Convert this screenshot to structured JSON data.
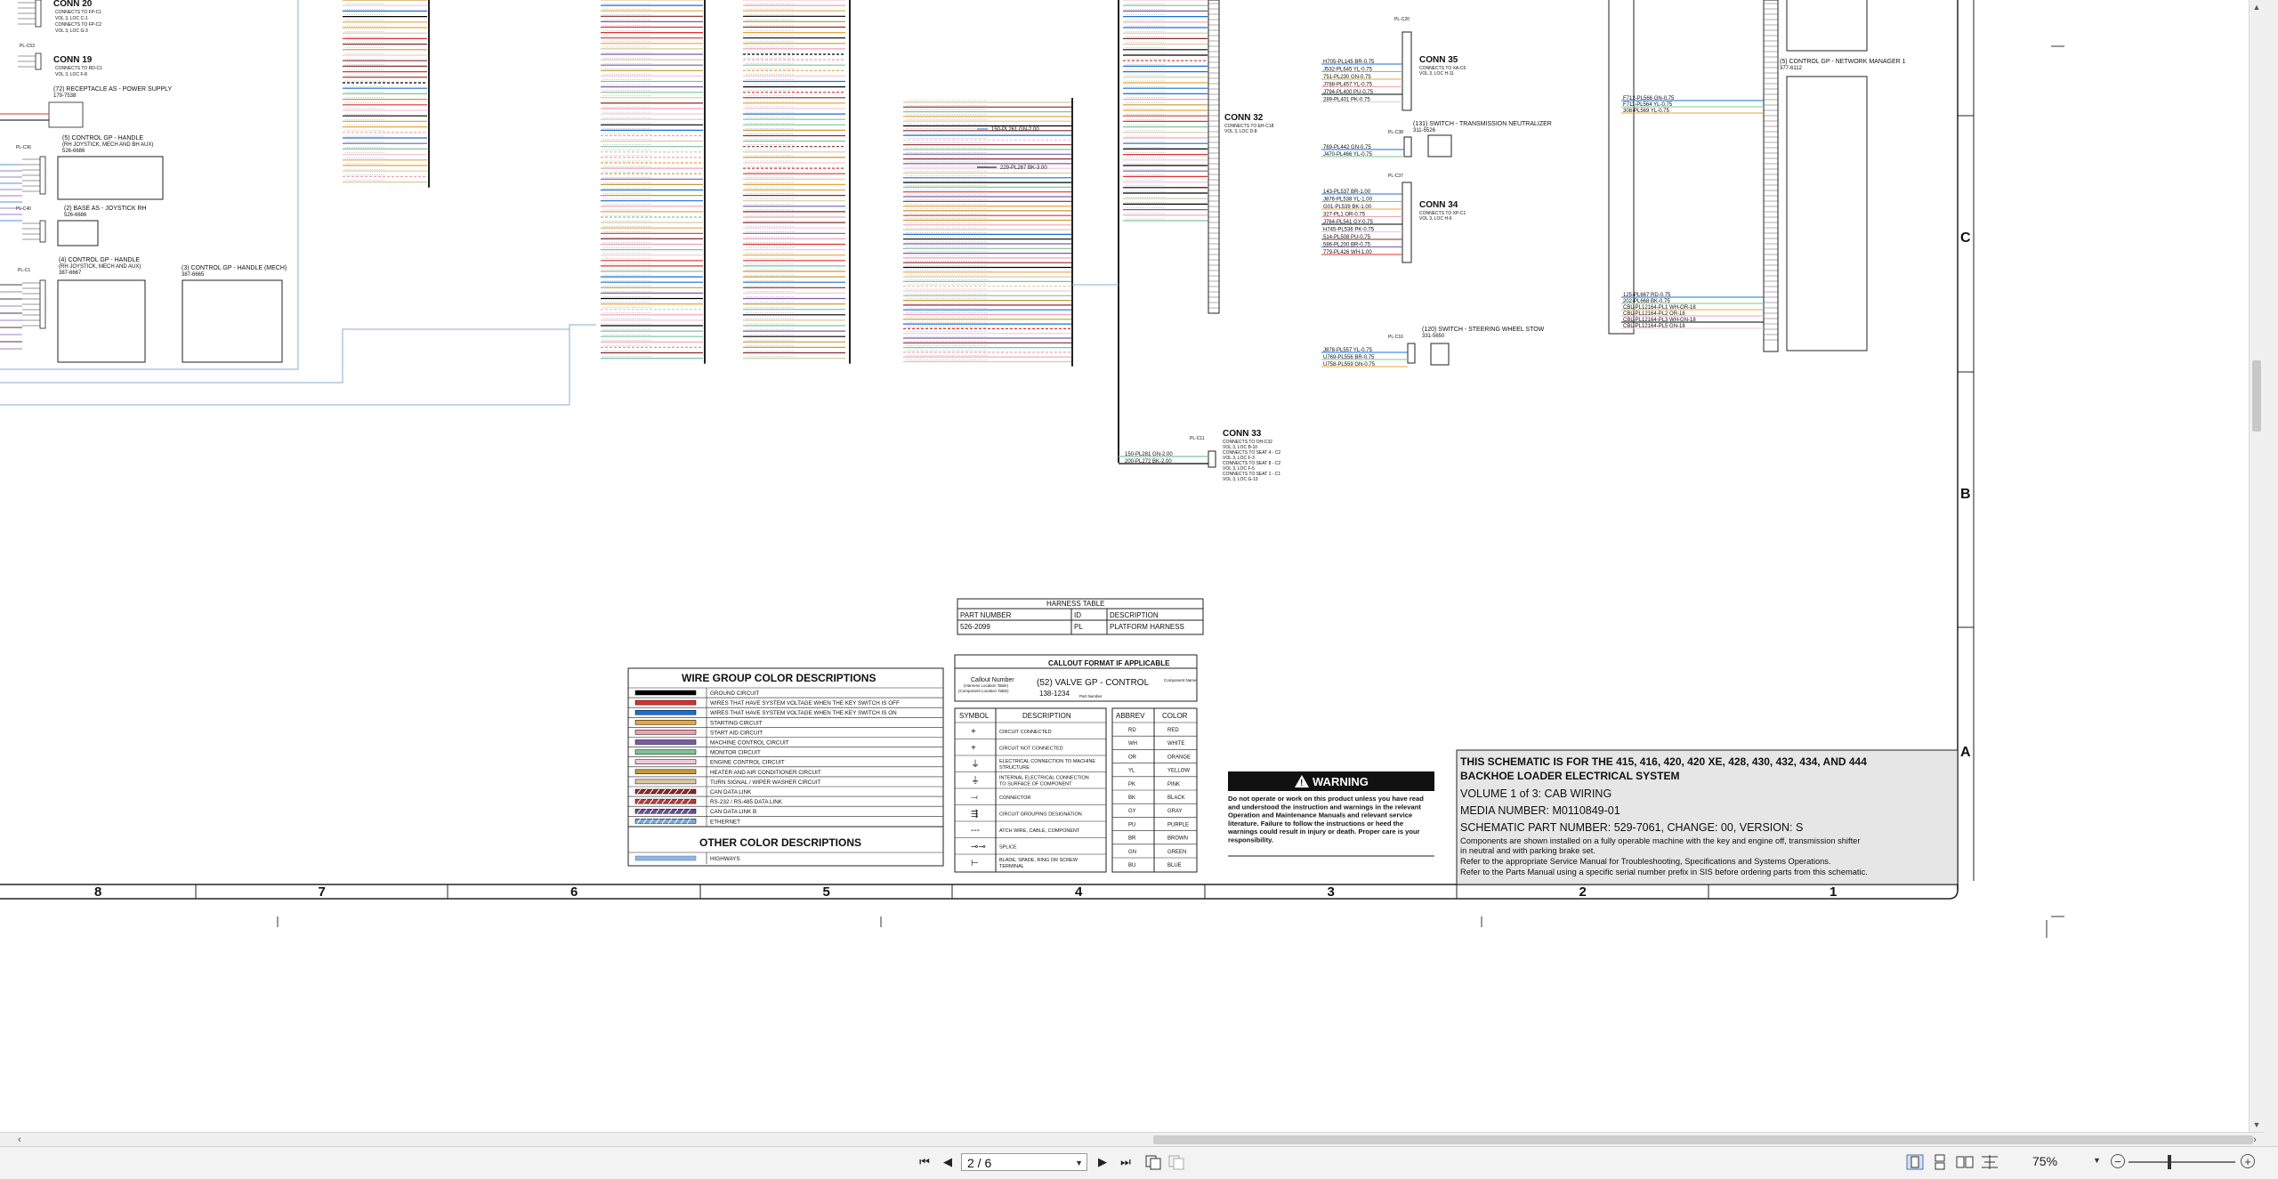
{
  "viewer": {
    "page_field": "2 / 6",
    "zoom": "75%",
    "nav": {
      "first": "⏮",
      "prev": "◀",
      "next": "▶",
      "last": "⏭"
    }
  },
  "schematic": {
    "zone_columns": [
      "8",
      "7",
      "6",
      "5",
      "4",
      "3",
      "2",
      "1"
    ],
    "zone_rows": [
      "C",
      "B",
      "A"
    ],
    "connectors_left": {
      "conn20": {
        "name": "CONN 20",
        "desc": [
          "CONNECTS TO FP-C1",
          "VOL 3, LOC C-1",
          "CONNECTS TO FP-C2",
          "VOL 3, LOC G-3"
        ]
      },
      "conn19": {
        "name": "CONN 19",
        "desc": [
          "CONNECTS TO RD-C1",
          "VOL 3, LOC F-8"
        ]
      },
      "plc53": "PL-C53",
      "receptacle": {
        "title": "(72) RECEPTACLE AS - POWER SUPPLY",
        "part": "179-7538"
      },
      "plc36": "PL-C36",
      "control5": {
        "title": "(5) CONTROL GP - HANDLE",
        "sub": "(RH JOYSTICK, MECH AND BH AUX)",
        "part": "526-6686"
      },
      "plc40": "PL-C40",
      "base": {
        "title": "(2) BASE AS - JOYSTICK RH",
        "part": "526-6686"
      },
      "plc1": "PL-C1",
      "control4": {
        "title": "(4) CONTROL GP - HANDLE",
        "sub": "(RH JOYSTICK, MECH AND AUX)",
        "part": "387-6667"
      },
      "control3": {
        "title": "(3) CONTROL GP - HANDLE (MECH)",
        "part": "387-6665"
      }
    },
    "conns_mid": {
      "conn32": {
        "name": "CONN 32",
        "desc": [
          "CONNECTS TO EH-C18",
          "VOL 3, LOC D-8"
        ]
      },
      "conn33": {
        "name": "CONN 33",
        "desc": [
          "CONNECTS TO OH-C32",
          "VOL 3, LOC B-10",
          "CONNECTS TO SEAT 4 - C2",
          "VOL 3, LOC F-3",
          "CONNECTS TO SEAT 8 - C2",
          "VOL 3, LOC F-5",
          "CONNECTS TO SEAT 1 - C1",
          "VOL 3, LOC G-13"
        ]
      },
      "plc11": "PL-C11"
    },
    "conns_right": {
      "conn35": {
        "name": "CONN 35",
        "desc": [
          "CONNECTS TO XA-C6",
          "VOL 3, LOC H-11"
        ]
      },
      "conn34": {
        "name": "CONN 34",
        "desc": [
          "CONNECTS TO XP-C1",
          "VOL 3, LOC H-6"
        ]
      },
      "switch131": {
        "title": "(131) SWITCH - TRANSMISSION NEUTRALIZER",
        "part": "311-5526"
      },
      "switch120": {
        "title": "(120) SWITCH - STEERING WHEEL STOW",
        "part": "331-5650"
      },
      "network": {
        "title": "(5) CONTROL GP - NETWORK MANAGER 1",
        "part": "377-6112"
      },
      "plc20": "PL-C20",
      "plc38": "PL-C38",
      "plc37": "PL-C37",
      "plc16": "PL-C16"
    },
    "wire_labels": {
      "mid_inline": [
        "150-PL261 GN-2.00",
        "229-PL267 BK-3.00"
      ],
      "right_top": [
        "F712-PL566 GN-0.75",
        "F711-PL564 YL-0.75",
        "308-PL569 YL-0.75"
      ],
      "right_bottom": [
        "125-PL667 RD-0.75",
        "202-PL668 BK-0.75",
        "CBL-PL12164-PL1 WH-OR-18",
        "CBL-PL12164-PL2 OR-18",
        "CBL-PL12164-PL3 WH-GN-18",
        "CBL-PL12164-PL5 GN-18"
      ],
      "conn35_wires": [
        "H705-PL145 BR-0.75",
        "J532-PL645 YL-0.75",
        "751-PL230 GN-0.75",
        "J788-PL457 YL-0.75",
        "J794-PL400 PU-0.75",
        "289-PL401 PK-0.75"
      ],
      "switch131_wires": [
        "769-PL442 GN-0.75",
        "J470-PL466 YL-0.75"
      ],
      "conn34_wires": [
        "143-PL537 BR-1.00",
        "J876-PL538 YL-1.00",
        "G01-PL539 BK-1.00",
        "327-PL1 OR-0.75",
        "J764-PL541 GY-0.75",
        "H745-PL536 PK-0.75",
        "514-PL508 PU-0.75",
        "586-PL200 BR-0.75",
        "779-PL426 WH-1.00"
      ],
      "switch120_wires": [
        "J878-PL557 YL-0.75",
        "U769-PL556 BR-0.75",
        "U758-PL559 GN-0.75"
      ],
      "conn33_wires": [
        "150-PL281 GN-2.00",
        "200-PL272 BK-2.00"
      ]
    },
    "harness_table": {
      "title": "HARNESS TABLE",
      "headers": [
        "PART NUMBER",
        "ID",
        "DESCRIPTION"
      ],
      "rows": [
        [
          "526-2099",
          "PL",
          "PLATFORM HARNESS"
        ]
      ]
    },
    "wire_group": {
      "title": "WIRE GROUP COLOR DESCRIPTIONS",
      "items": [
        {
          "label": "GROUND CIRCUIT",
          "c1": "#000000",
          "c2": "#000000"
        },
        {
          "label": "WIRES THAT HAVE SYSTEM VOLTAGE WHEN THE KEY SWITCH IS OFF",
          "c1": "#e03030",
          "c2": "#e03030"
        },
        {
          "label": "WIRES THAT HAVE SYSTEM VOLTAGE WHEN THE KEY SWITCH IS ON",
          "c1": "#1a6fd8",
          "c2": "#1a6fd8"
        },
        {
          "label": "STARTING CIRCUIT",
          "c1": "#e8a53c",
          "c2": "#e8a53c"
        },
        {
          "label": "START AID CIRCUIT",
          "c1": "#f0a0b0",
          "c2": "#f0a0b0"
        },
        {
          "label": "MACHINE CONTROL CIRCUIT",
          "c1": "#7b5aa6",
          "c2": "#7b5aa6"
        },
        {
          "label": "MONITOR CIRCUIT",
          "c1": "#7fc39a",
          "c2": "#7fc39a"
        },
        {
          "label": "ENGINE CONTROL CIRCUIT",
          "c1": "#f4c6d8",
          "c2": "#f4c6d8"
        },
        {
          "label": "HEATER AND AIR CONDITIONER CIRCUIT",
          "c1": "#c79a3a",
          "c2": "#c79a3a"
        },
        {
          "label": "TURN SIGNAL / WIPER WASHER CIRCUIT",
          "c1": "#d8c9a0",
          "c2": "#d8c9a0"
        },
        {
          "label": "CAN DATA LINK",
          "c1": "#8a2a2a",
          "c2": "#8a2a2a",
          "hatch": true
        },
        {
          "label": "RS-232 / RS-485 DATA LINK",
          "c1": "#b04040",
          "c2": "#b04040",
          "hatch": true
        },
        {
          "label": "CAN DATA LINK B",
          "c1": "#6b4f8f",
          "c2": "#6b4f8f",
          "hatch": true
        },
        {
          "label": "ETHERNET",
          "c1": "#7aa7d6",
          "c2": "#7aa7d6",
          "hatch": true
        }
      ],
      "other_title": "OTHER COLOR DESCRIPTIONS",
      "other_items": [
        {
          "label": "HIGHWAYS",
          "c1": "#8db6e0",
          "c2": "#8db6e0"
        }
      ]
    },
    "callout": {
      "title": "CALLOUT FORMAT IF APPLICABLE",
      "callout_number": "Callout Number",
      "callout_sub": "(Harness Location Table)",
      "component_location": "(Component Location Table)",
      "example": "(52) VALVE GP - CONTROL",
      "part": "138-1234",
      "component_name": "Component Name",
      "part_number": "Part Number",
      "symbol_header": "SYMBOL",
      "desc_header": "DESCRIPTION",
      "symbols": [
        {
          "sym": "+",
          "desc": "CIRCUIT CONNECTED"
        },
        {
          "sym": "+",
          "desc": "CIRCUIT NOT CONNECTED"
        },
        {
          "sym": "⏚",
          "desc": "ELECTRICAL CONNECTION TO MACHINE STRUCTURE"
        },
        {
          "sym": "⏚",
          "desc": "INTERNAL ELECTRICAL CONNECTION TO SURFACE OF COMPONENT"
        },
        {
          "sym": "⤙",
          "desc": "CONNECTOR"
        },
        {
          "sym": "⇶",
          "desc": "CIRCUIT GROUPING DESIGNATION"
        },
        {
          "sym": "---",
          "desc": "ATCH WIRE, CABLE, COMPONENT"
        },
        {
          "sym": "⊸⊸",
          "desc": "SPLICE"
        },
        {
          "sym": "⊢",
          "desc": "BLADE, SPADE, RING OR SCREW TERMINAL"
        }
      ]
    },
    "abbrev": {
      "headers": [
        "ABBREV",
        "COLOR"
      ],
      "rows": [
        [
          "RD",
          "RED"
        ],
        [
          "WH",
          "WHITE"
        ],
        [
          "OR",
          "ORANGE"
        ],
        [
          "YL",
          "YELLOW"
        ],
        [
          "PK",
          "PINK"
        ],
        [
          "BK",
          "BLACK"
        ],
        [
          "GY",
          "GRAY"
        ],
        [
          "PU",
          "PURPLE"
        ],
        [
          "BR",
          "BROWN"
        ],
        [
          "GN",
          "GREEN"
        ],
        [
          "BU",
          "BLUE"
        ]
      ]
    },
    "warning": {
      "title": "WARNING",
      "text": "Do not operate or work on this product unless you have read and understood the instruction and warnings in the relevant Operation and Maintenance Manuals and relevant service literature. Failure to follow the instructions or heed the warnings could result in injury or death. Proper care is your responsibility."
    },
    "titleblock": {
      "line1": "THIS SCHEMATIC IS FOR THE 415, 416, 420, 420 XE, 428, 430, 432, 434, AND 444",
      "line2": "BACKHOE LOADER ELECTRICAL SYSTEM",
      "volume": "VOLUME 1 of 3: CAB WIRING",
      "media": "MEDIA NUMBER: M0110849-01",
      "schematic_part": "SCHEMATIC PART NUMBER: 529-7061, CHANGE: 00, VERSION: S",
      "note1": "Components are shown installed on a fully operable machine with the key and engine off, transmission shifter",
      "note2": "in neutral and with parking brake set.",
      "note3": "Refer to the appropriate Service Manual for Troubleshooting, Specifications and Systems Operations.",
      "note4": "Refer to the Parts Manual using a specific serial number prefix in SIS before ordering parts from this schematic."
    }
  }
}
